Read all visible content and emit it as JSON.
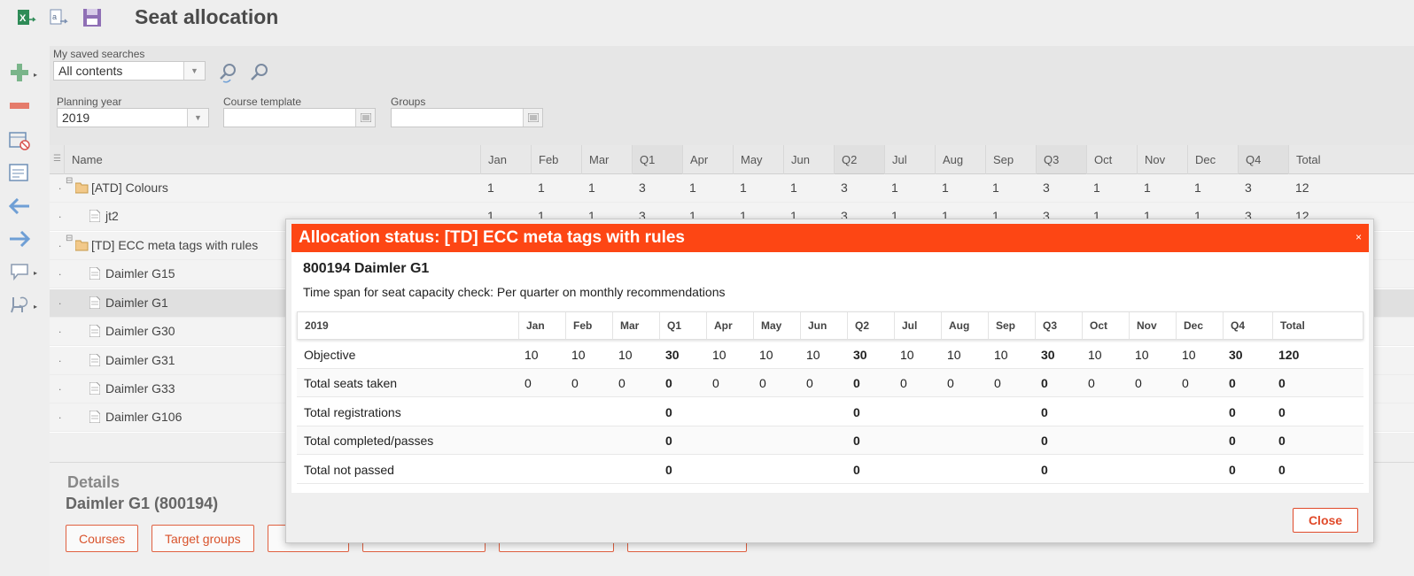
{
  "app": {
    "title": "Seat allocation"
  },
  "search": {
    "saved_label": "My saved searches",
    "saved_value": "All contents"
  },
  "filters": {
    "planning_year_label": "Planning year",
    "planning_year_value": "2019",
    "course_template_label": "Course template",
    "course_template_value": "",
    "groups_label": "Groups",
    "groups_value": ""
  },
  "grid": {
    "name_header": "Name",
    "columns": [
      "Jan",
      "Feb",
      "Mar",
      "Q1",
      "Apr",
      "May",
      "Jun",
      "Q2",
      "Jul",
      "Aug",
      "Sep",
      "Q3",
      "Oct",
      "Nov",
      "Dec",
      "Q4",
      "Total"
    ],
    "rows": [
      {
        "name": "[ATD] Colours",
        "values": [
          "1",
          "1",
          "1",
          "3",
          "1",
          "1",
          "1",
          "3",
          "1",
          "1",
          "1",
          "3",
          "1",
          "1",
          "1",
          "3",
          "12"
        ]
      },
      {
        "name": "jt2",
        "values": [
          "1",
          "1",
          "1",
          "3",
          "1",
          "1",
          "1",
          "3",
          "1",
          "1",
          "1",
          "3",
          "1",
          "1",
          "1",
          "3",
          "12"
        ]
      },
      {
        "name": "[TD] ECC meta tags with rules",
        "values": []
      },
      {
        "name": "Daimler G15",
        "values": []
      },
      {
        "name": "Daimler G1",
        "values": []
      },
      {
        "name": "Daimler G30",
        "values": []
      },
      {
        "name": "Daimler G31",
        "values": []
      },
      {
        "name": "Daimler G33",
        "values": []
      },
      {
        "name": "Daimler G106",
        "values": []
      }
    ]
  },
  "details": {
    "title": "Details",
    "subtitle": "Daimler G1 (800194)",
    "buttons": [
      "Courses",
      "Target groups"
    ]
  },
  "modal": {
    "title": "Allocation status: [TD] ECC meta tags with rules",
    "heading": "800194 Daimler G1",
    "subtitle": "Time span for seat capacity check: Per quarter on monthly recommendations",
    "year": "2019",
    "columns": [
      "Jan",
      "Feb",
      "Mar",
      "Q1",
      "Apr",
      "May",
      "Jun",
      "Q2",
      "Jul",
      "Aug",
      "Sep",
      "Q3",
      "Oct",
      "Nov",
      "Dec",
      "Q4",
      "Total"
    ],
    "rows": [
      {
        "label": "Objective",
        "values": [
          "10",
          "10",
          "10",
          "30",
          "10",
          "10",
          "10",
          "30",
          "10",
          "10",
          "10",
          "30",
          "10",
          "10",
          "10",
          "30",
          "120"
        ]
      },
      {
        "label": "Total seats taken",
        "values": [
          "0",
          "0",
          "0",
          "0",
          "0",
          "0",
          "0",
          "0",
          "0",
          "0",
          "0",
          "0",
          "0",
          "0",
          "0",
          "0",
          "0"
        ]
      },
      {
        "label": "Total registrations",
        "values": [
          "",
          "",
          "",
          "0",
          "",
          "",
          "",
          "0",
          "",
          "",
          "",
          "0",
          "",
          "",
          "",
          "0",
          "0"
        ]
      },
      {
        "label": "Total completed/passes",
        "values": [
          "",
          "",
          "",
          "0",
          "",
          "",
          "",
          "0",
          "",
          "",
          "",
          "0",
          "",
          "",
          "",
          "0",
          "0"
        ]
      },
      {
        "label": "Total not passed",
        "values": [
          "",
          "",
          "",
          "0",
          "",
          "",
          "",
          "0",
          "",
          "",
          "",
          "0",
          "",
          "",
          "",
          "0",
          "0"
        ]
      }
    ],
    "close_label": "Close",
    "close_x": "×"
  },
  "colors": {
    "accent": "#fd4614",
    "button_border": "#e04a2a"
  }
}
